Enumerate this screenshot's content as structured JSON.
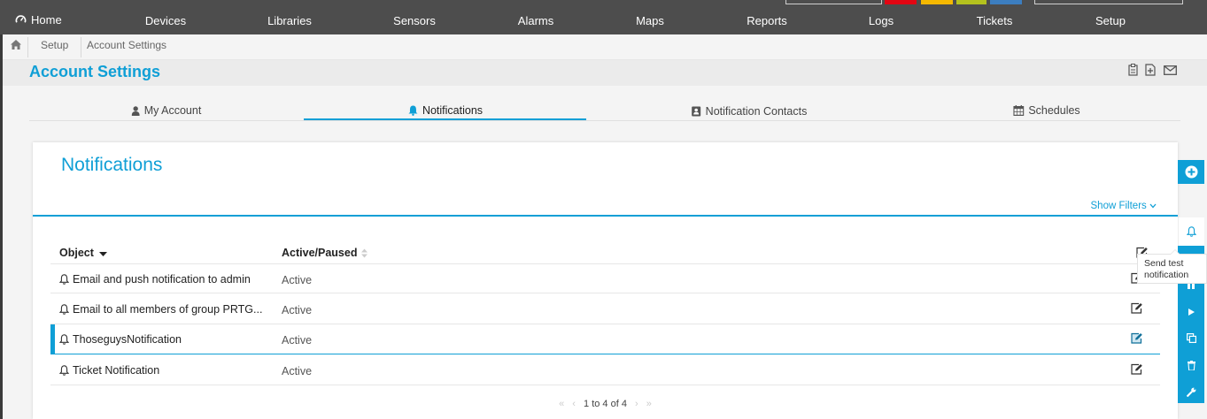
{
  "nav": {
    "home": "Home",
    "items": [
      "Devices",
      "Libraries",
      "Sensors",
      "Alarms",
      "Maps",
      "Reports",
      "Logs",
      "Tickets",
      "Setup"
    ],
    "status_colors": [
      "#e30613",
      "#f5b800",
      "#b4c21e",
      "#3c7ec0"
    ]
  },
  "breadcrumb": {
    "setup": "Setup",
    "current": "Account Settings"
  },
  "page": {
    "title": "Account Settings"
  },
  "tabs": [
    {
      "label": "My Account",
      "icon": "user-icon"
    },
    {
      "label": "Notifications",
      "icon": "bell-icon"
    },
    {
      "label": "Notification Contacts",
      "icon": "address-book-icon"
    },
    {
      "label": "Schedules",
      "icon": "calendar-icon"
    }
  ],
  "panel": {
    "title": "Notifications",
    "show_filters": "Show Filters",
    "columns": {
      "object": "Object",
      "status": "Active/Paused"
    },
    "rows": [
      {
        "name": "Email and push notification to admin",
        "status": "Active"
      },
      {
        "name": "Email to all members of group PRTG...",
        "status": "Active"
      },
      {
        "name": "ThoseguysNotification",
        "status": "Active"
      },
      {
        "name": "Ticket Notification",
        "status": "Active"
      }
    ],
    "pager": "1 to 4 of 4"
  },
  "tooltip": {
    "line1": "Send test",
    "line2": "notification"
  },
  "colors": {
    "accent": "#0f9fd6",
    "nav_bg": "#4d4d4d"
  }
}
